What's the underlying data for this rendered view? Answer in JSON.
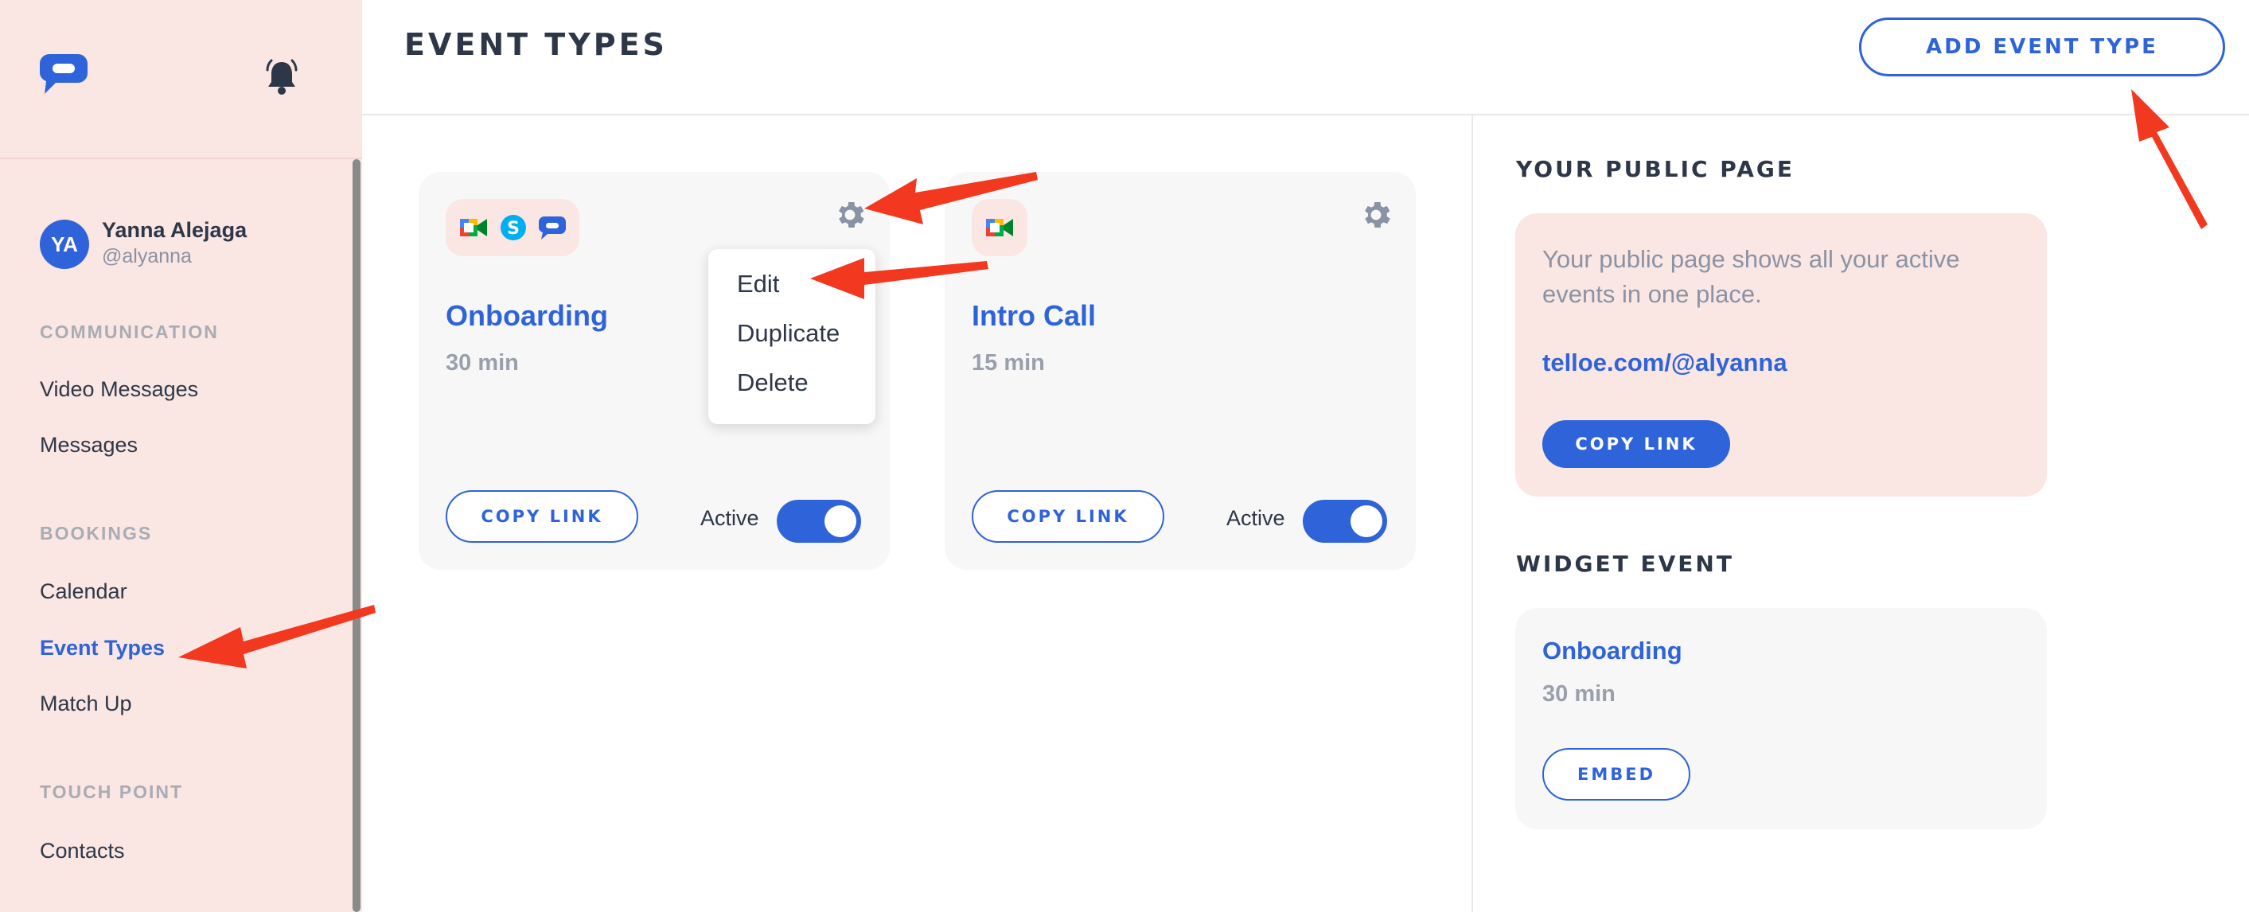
{
  "sidebar": {
    "user": {
      "initials": "YA",
      "name": "Yanna Alejaga",
      "handle": "@alyanna"
    },
    "sections": [
      {
        "label": "COMMUNICATION",
        "items": [
          "Video Messages",
          "Messages"
        ]
      },
      {
        "label": "BOOKINGS",
        "items": [
          "Calendar",
          "Event Types",
          "Match Up"
        ]
      },
      {
        "label": "TOUCH POINT",
        "items": [
          "Contacts"
        ]
      }
    ],
    "active_item": "Event Types"
  },
  "header": {
    "title": "EVENT TYPES",
    "add_button": "ADD EVENT TYPE"
  },
  "event_cards": [
    {
      "title": "Onboarding",
      "duration": "30 min",
      "copy_label": "COPY LINK",
      "active_label": "Active",
      "active": true,
      "icons": [
        "google-meet-icon",
        "skype-icon",
        "chat-bubble-icon"
      ]
    },
    {
      "title": "Intro Call",
      "duration": "15 min",
      "copy_label": "COPY LINK",
      "active_label": "Active",
      "active": true,
      "icons": [
        "google-meet-icon"
      ]
    }
  ],
  "dropdown": {
    "items": [
      "Edit",
      "Duplicate",
      "Delete"
    ]
  },
  "public_page": {
    "heading": "YOUR PUBLIC PAGE",
    "description": "Your public page shows all your active events in one place.",
    "link": "telloe.com/@alyanna",
    "copy_label": "COPY LINK"
  },
  "widget_event": {
    "heading": "WIDGET EVENT",
    "title": "Onboarding",
    "duration": "30 min",
    "embed_label": "EMBED"
  },
  "colors": {
    "accent": "#2f63d9",
    "sidebar_bg": "#fae6e3",
    "annotation_arrow": "#f2391f"
  }
}
